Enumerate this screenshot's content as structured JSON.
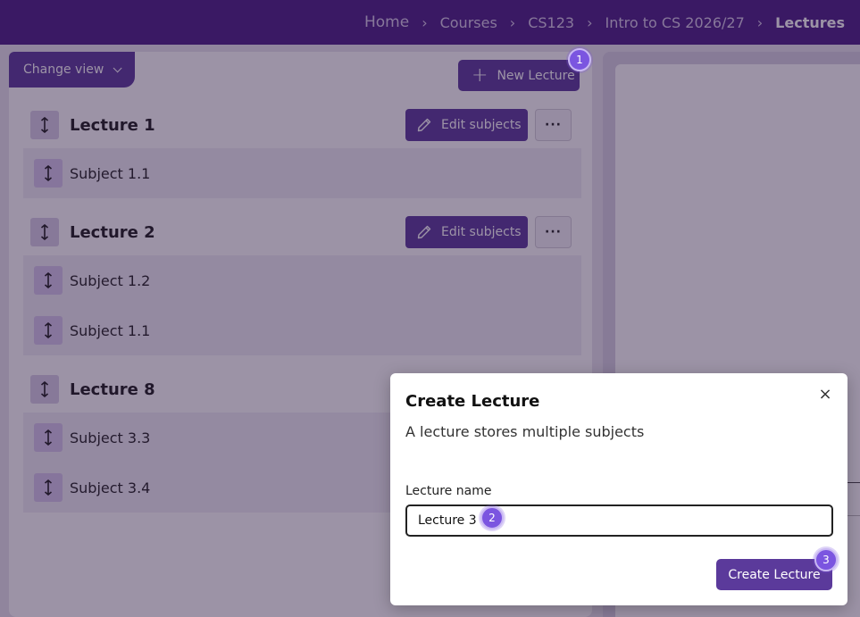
{
  "breadcrumb": {
    "items": [
      "Home",
      "Courses",
      "CS123",
      "Intro to CS 2026/27",
      "Lectures"
    ],
    "separator": "›"
  },
  "toolbar": {
    "change_view_label": "Change view",
    "new_lecture_label": "New Lecture"
  },
  "lectures": [
    {
      "title": "Lecture 1",
      "edit_label": "Edit subjects",
      "more_label": "···",
      "subjects": [
        "Subject 1.1"
      ]
    },
    {
      "title": "Lecture 2",
      "edit_label": "Edit subjects",
      "more_label": "···",
      "subjects": [
        "Subject 1.2",
        "Subject 1.1"
      ]
    },
    {
      "title": "Lecture 8",
      "subjects": [
        "Subject 3.3",
        "Subject 3.4"
      ]
    }
  ],
  "modal": {
    "title": "Create Lecture",
    "description": "A lecture stores multiple subjects",
    "close_glyph": "×",
    "field_label": "Lecture name",
    "field_value": "Lecture 3",
    "submit_label": "Create Lecture"
  },
  "step_badges": [
    "1",
    "2",
    "3"
  ],
  "colors": {
    "brand": "#4a1e85",
    "primary_button": "#5b3a9b",
    "badge": "#7b55e0"
  }
}
